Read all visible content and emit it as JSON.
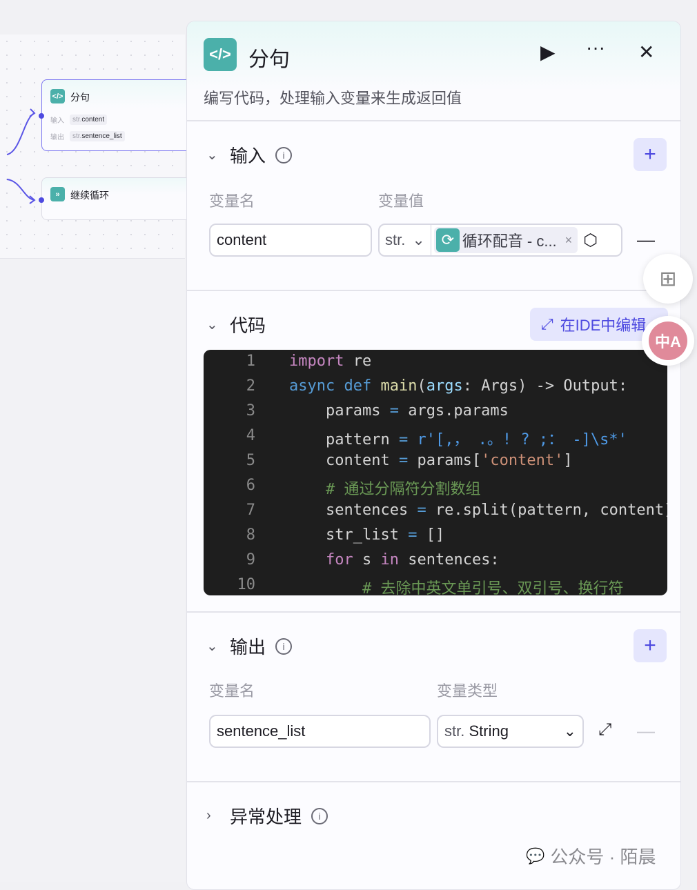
{
  "canvas": {
    "node1": {
      "title": "分句",
      "in_label": "输入",
      "in_type": "str.",
      "in_var": "content",
      "out_label": "输出",
      "out_type": "str.",
      "out_var": "sentence_list"
    },
    "node2": {
      "title": "继续循环"
    }
  },
  "panel": {
    "title": "分句",
    "description": "编写代码，处理输入变量来生成返回值",
    "input": {
      "title": "输入",
      "col_name": "变量名",
      "col_value": "变量值",
      "name_value": "content",
      "type": "str.",
      "ref_label": "循环配音 - c..."
    },
    "code": {
      "title": "代码",
      "ide_button": "在IDE中编辑",
      "lines": [
        [
          [
            "import",
            "kw"
          ],
          [
            " re",
            ""
          ]
        ],
        [
          [
            "async",
            "bl"
          ],
          [
            " ",
            ""
          ],
          [
            "def",
            "bl"
          ],
          [
            " ",
            ""
          ],
          [
            "main",
            "fn"
          ],
          [
            "(",
            ""
          ],
          [
            "args",
            "va"
          ],
          [
            ": Args) -> Output:",
            ""
          ]
        ],
        [
          [
            "    params ",
            ""
          ],
          [
            "=",
            "op"
          ],
          [
            " args.params",
            ""
          ]
        ],
        [
          [
            "    pattern ",
            ""
          ],
          [
            "=",
            "op"
          ],
          [
            " ",
            ""
          ],
          [
            "r'[,， .。! ? ;： -]\\s*'",
            "rx"
          ]
        ],
        [
          [
            "    content ",
            ""
          ],
          [
            "=",
            "op"
          ],
          [
            " params[",
            ""
          ],
          [
            "'content'",
            "st"
          ],
          [
            "]",
            ""
          ]
        ],
        [
          [
            "    # 通过分隔符分割数组",
            "cm"
          ]
        ],
        [
          [
            "    sentences ",
            ""
          ],
          [
            "=",
            "op"
          ],
          [
            " re.split(pattern, content)",
            ""
          ]
        ],
        [
          [
            "    str_list ",
            ""
          ],
          [
            "=",
            "op"
          ],
          [
            " []",
            ""
          ]
        ],
        [
          [
            "    ",
            ""
          ],
          [
            "for",
            "kw"
          ],
          [
            " s ",
            ""
          ],
          [
            "in",
            "kw"
          ],
          [
            " sentences:",
            ""
          ]
        ],
        [
          [
            "        # 去除中英文单引号、双引号、换行符",
            "cm"
          ]
        ]
      ]
    },
    "output": {
      "title": "输出",
      "col_name": "变量名",
      "col_type": "变量类型",
      "name_value": "sentence_list",
      "type_prefix": "str.",
      "type_value": "String"
    },
    "error": {
      "title": "异常处理"
    }
  },
  "watermark": "公众号 · 陌晨",
  "colors": {
    "accent": "#4e4ae0",
    "teal": "#4bb0aa"
  }
}
